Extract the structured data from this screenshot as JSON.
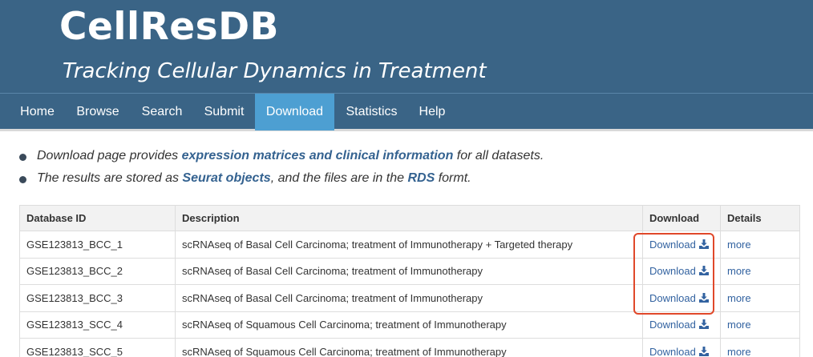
{
  "header": {
    "brand": "CellResDB",
    "tagline": "Tracking Cellular Dynamics in Treatment"
  },
  "nav": {
    "items": [
      {
        "label": "Home"
      },
      {
        "label": "Browse"
      },
      {
        "label": "Search"
      },
      {
        "label": "Submit"
      },
      {
        "label": "Download"
      },
      {
        "label": "Statistics"
      },
      {
        "label": "Help"
      }
    ],
    "active": "Download"
  },
  "notes": [
    {
      "pre": "Download page provides ",
      "bold": "expression matrices and clinical information",
      "mid": " for all datasets.",
      "bold2": "",
      "post": ""
    },
    {
      "pre": "The results are stored as ",
      "bold": "Seurat objects",
      "mid": ", and the files are in the ",
      "bold2": "RDS",
      "post": " formt."
    }
  ],
  "table": {
    "headers": [
      "Database ID",
      "Description",
      "Download",
      "Details"
    ],
    "rows": [
      {
        "id": "GSE123813_BCC_1",
        "description": "scRNAseq of Basal Cell Carcinoma; treatment of Immunotherapy + Targeted therapy",
        "download": "Download",
        "details": "more"
      },
      {
        "id": "GSE123813_BCC_2",
        "description": "scRNAseq of Basal Cell Carcinoma; treatment of Immunotherapy",
        "download": "Download",
        "details": "more"
      },
      {
        "id": "GSE123813_BCC_3",
        "description": "scRNAseq of Basal Cell Carcinoma; treatment of Immunotherapy",
        "download": "Download",
        "details": "more"
      },
      {
        "id": "GSE123813_SCC_4",
        "description": "scRNAseq of Squamous Cell Carcinoma; treatment of Immunotherapy",
        "download": "Download",
        "details": "more"
      },
      {
        "id": "GSE123813_SCC_5",
        "description": "scRNAseq of Squamous Cell Carcinoma; treatment of Immunotherapy",
        "download": "Download",
        "details": "more"
      }
    ]
  },
  "colors": {
    "banner": "#3a6486",
    "nav_active": "#4d9fd2",
    "link": "#3262a0",
    "highlight": "#e0482a"
  },
  "icons": {
    "download": "download-icon"
  }
}
